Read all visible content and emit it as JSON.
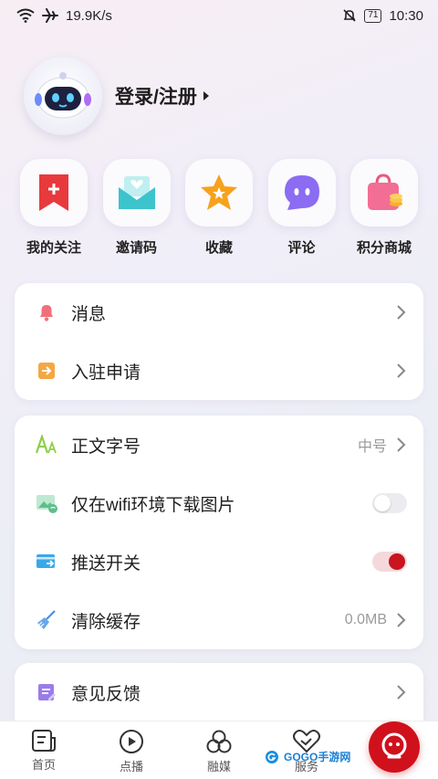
{
  "status": {
    "speed": "19.9K/s",
    "battery": "71",
    "time": "10:30"
  },
  "profile": {
    "login_label": "登录/注册"
  },
  "shortcuts": [
    {
      "label": "我的关注",
      "icon": "bookmark-plus-icon"
    },
    {
      "label": "邀请码",
      "icon": "envelope-heart-icon"
    },
    {
      "label": "收藏",
      "icon": "star-icon"
    },
    {
      "label": "评论",
      "icon": "chat-bubble-icon"
    },
    {
      "label": "积分商城",
      "icon": "shopping-bag-icon"
    }
  ],
  "card1": [
    {
      "label": "消息",
      "icon": "bell-icon"
    },
    {
      "label": "入驻申请",
      "icon": "enter-icon"
    }
  ],
  "card2": [
    {
      "label": "正文字号",
      "value": "中号",
      "icon": "font-size-icon"
    },
    {
      "label": "仅在wifi环境下载图片",
      "toggle": false,
      "icon": "image-wifi-icon"
    },
    {
      "label": "推送开关",
      "toggle": true,
      "icon": "push-icon"
    },
    {
      "label": "清除缓存",
      "value": "0.0MB",
      "icon": "broom-icon"
    }
  ],
  "card3": [
    {
      "label": "意见反馈",
      "icon": "feedback-icon"
    }
  ],
  "nav": [
    {
      "label": "首页",
      "icon": "news-icon"
    },
    {
      "label": "点播",
      "icon": "play-icon"
    },
    {
      "label": "融媒",
      "icon": "circles-icon"
    },
    {
      "label": "服务",
      "icon": "handshake-icon"
    }
  ],
  "watermark": "GOGO手游网",
  "colors": {
    "accent": "#d0111c",
    "background": "#eeeef6"
  }
}
